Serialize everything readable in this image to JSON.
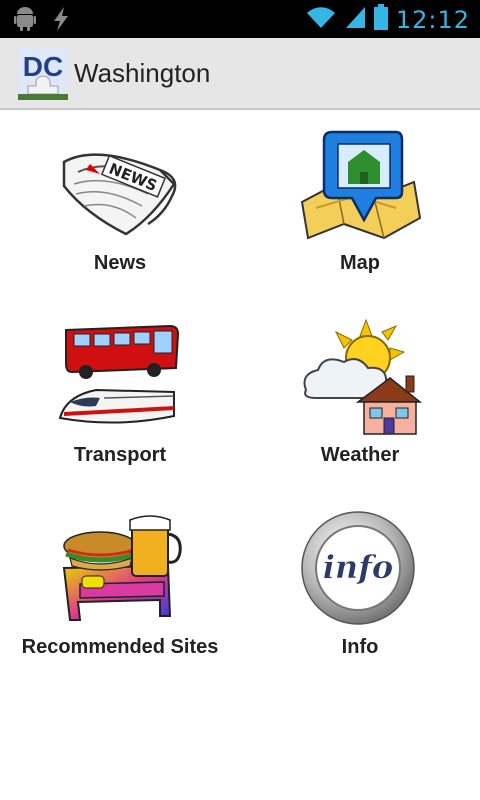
{
  "status": {
    "clock": "12:12",
    "icons": [
      "android-icon",
      "usb-debug-icon",
      "wifi-icon",
      "signal-icon",
      "battery-icon"
    ]
  },
  "app": {
    "title": "Washington",
    "icon_text": "DC"
  },
  "tiles": [
    {
      "label": "News",
      "icon": "newspaper-icon"
    },
    {
      "label": "Map",
      "icon": "map-pin-icon"
    },
    {
      "label": "Transport",
      "icon": "bus-train-icon"
    },
    {
      "label": "Weather",
      "icon": "weather-icon"
    },
    {
      "label": "Recommended Sites",
      "icon": "food-bed-icon"
    },
    {
      "label": "Info",
      "icon": "info-icon"
    }
  ],
  "colors": {
    "accent": "#33b5e5",
    "actionbar": "#e6e6e6"
  }
}
